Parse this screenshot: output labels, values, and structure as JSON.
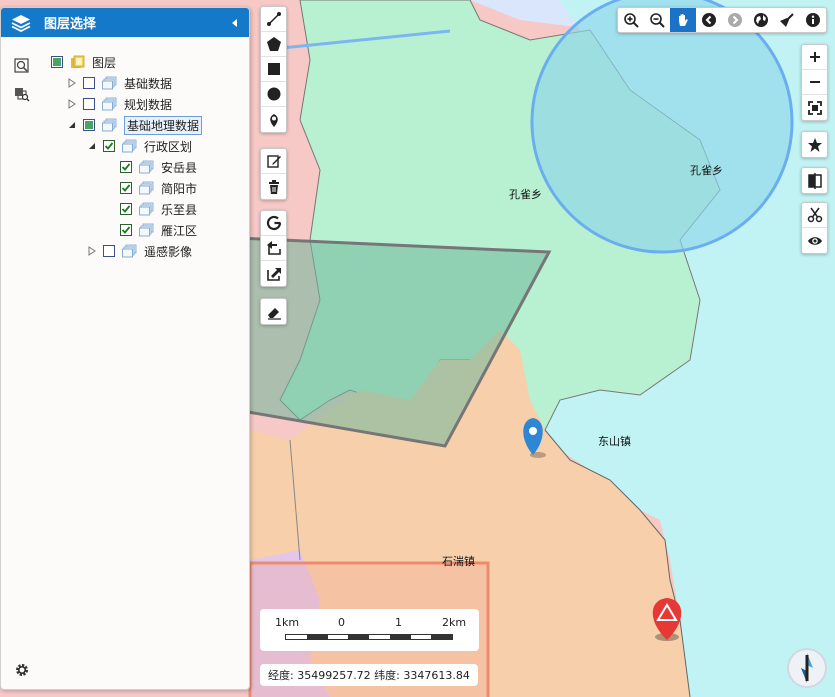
{
  "panel": {
    "title": "图层选择",
    "tree": [
      {
        "label": "图层",
        "level": 0,
        "expander": "none",
        "check": "partial",
        "icon": "folder-icon"
      },
      {
        "label": "基础数据",
        "level": 1,
        "expander": "collapsed",
        "check": "unchecked",
        "icon": "layer-stack-icon"
      },
      {
        "label": "规划数据",
        "level": 1,
        "expander": "collapsed",
        "check": "unchecked",
        "icon": "layer-stack-icon"
      },
      {
        "label": "基础地理数据",
        "level": 1,
        "expander": "expanded",
        "check": "partial",
        "icon": "layer-stack-icon",
        "selected": true
      },
      {
        "label": "行政区划",
        "level": 2,
        "expander": "expanded",
        "check": "checked",
        "icon": "layer-stack-icon"
      },
      {
        "label": "安岳县",
        "level": 3,
        "expander": "none",
        "check": "checked",
        "icon": "layer-stack-icon"
      },
      {
        "label": "简阳市",
        "level": 3,
        "expander": "none",
        "check": "checked",
        "icon": "layer-stack-icon"
      },
      {
        "label": "乐至县",
        "level": 3,
        "expander": "none",
        "check": "checked",
        "icon": "layer-stack-icon"
      },
      {
        "label": "雁江区",
        "level": 3,
        "expander": "none",
        "check": "checked",
        "icon": "layer-stack-icon"
      },
      {
        "label": "遥感影像",
        "level": 2,
        "expander": "collapsed",
        "check": "unchecked",
        "icon": "layer-stack-icon"
      }
    ]
  },
  "map": {
    "labels": {
      "kongque_inner": "孔雀乡",
      "kongque_outer": "孔雀乡",
      "dongshan": "东山镇",
      "shiman": "石湍镇"
    },
    "colors": {
      "pink_region": "#f6c8c6",
      "green_region": "#b8f0d2",
      "cyan_region": "#c2f3f4",
      "orange_region": "#f7cfab",
      "purple_region": "#e3c6e8",
      "circle_fill": "#8fd6ea",
      "circle_stroke": "#6aaef0",
      "polygon_fill": "#6fb89a",
      "polygon_stroke": "#767676",
      "rect_stroke": "#ee8b6f",
      "toolbar_active": "#1a73c7"
    }
  },
  "scale": {
    "labels": [
      "1km",
      "0",
      "1",
      "2km"
    ]
  },
  "coords": {
    "text": "经度: 35499257.72 纬度: 3347613.84"
  }
}
